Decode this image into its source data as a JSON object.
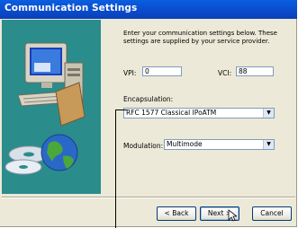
{
  "window": {
    "title": "Communication Settings"
  },
  "instructions": "Enter your communication settings below.  These settings are supplied by your service provider.",
  "vpi": {
    "label": "VPI:",
    "value": "0"
  },
  "vci": {
    "label": "VCI:",
    "value": "88"
  },
  "encapsulation": {
    "label": "Encapsulation:",
    "value": "RFC 1577 Classical IPoATM"
  },
  "modulation": {
    "label": "Modulation:",
    "value": "Multimode"
  },
  "buttons": {
    "back": "< Back",
    "next": "Next >",
    "cancel": "Cancel"
  },
  "colors": {
    "titlebar": "#0a4fd0",
    "panel": "#2b8c8c",
    "dialog": "#ece9d8"
  },
  "icons": [
    "computer-illustration-icon",
    "globe-icon",
    "cd-disc-icon",
    "mouse-cursor-icon",
    "dropdown-arrow-icon"
  ]
}
